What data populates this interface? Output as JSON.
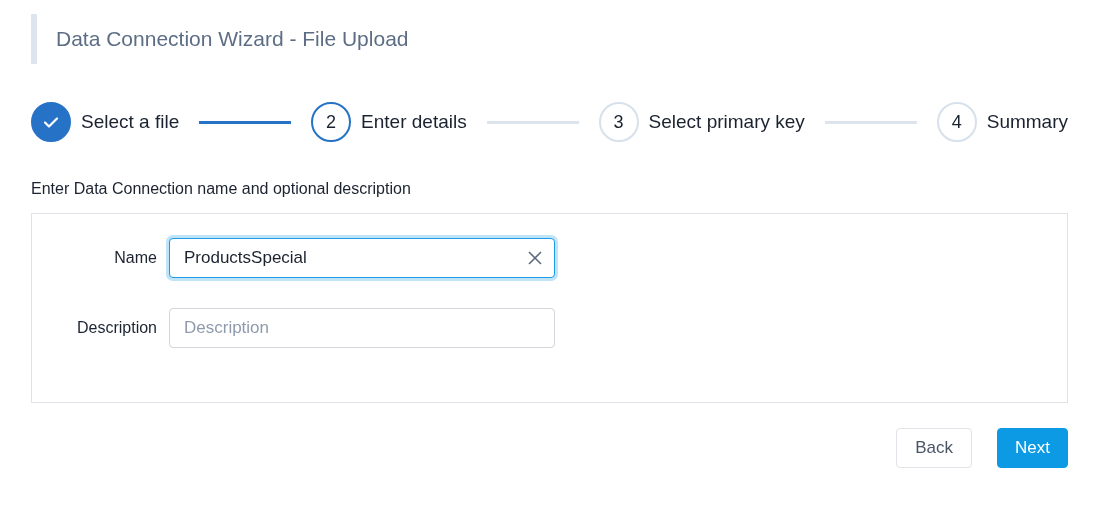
{
  "title": "Data Connection Wizard - File Upload",
  "steps": [
    {
      "label": "Select a file",
      "done": true,
      "selected": false
    },
    {
      "number": "2",
      "label": "Enter details",
      "done": false,
      "selected": true
    },
    {
      "number": "3",
      "label": "Select primary key",
      "done": false,
      "selected": false
    },
    {
      "number": "4",
      "label": "Summary",
      "done": false,
      "selected": false
    }
  ],
  "instructions": "Enter Data Connection name and optional description",
  "fields": [
    {
      "label": "Name",
      "value": "ProductsSpecial",
      "focused": true,
      "clearable": true
    },
    {
      "label": "Description",
      "placeholder": "Description",
      "focused": false,
      "clearable": false
    }
  ],
  "buttons": [
    {
      "label": "Back",
      "kind": "secondary"
    },
    {
      "label": "Next",
      "kind": "primary"
    }
  ]
}
